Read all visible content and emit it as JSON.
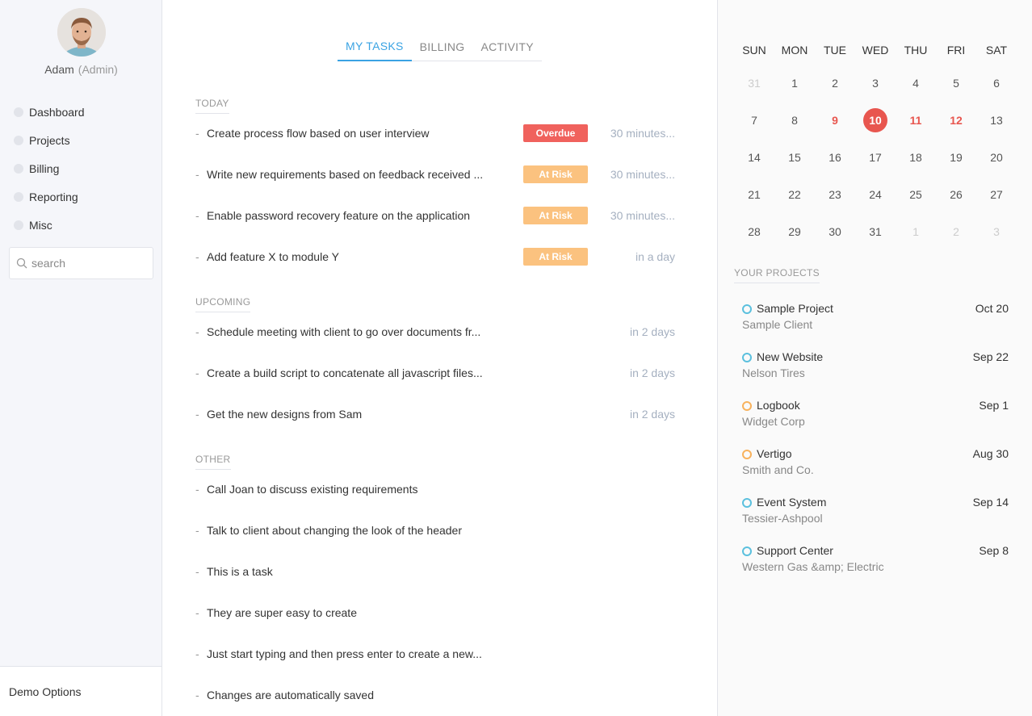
{
  "user": {
    "name": "Adam",
    "role": "(Admin)"
  },
  "sidebar": {
    "items": [
      {
        "label": "Dashboard"
      },
      {
        "label": "Projects"
      },
      {
        "label": "Billing"
      },
      {
        "label": "Reporting"
      },
      {
        "label": "Misc"
      }
    ],
    "search_placeholder": "search",
    "demo_label": "Demo Options"
  },
  "tabs": [
    {
      "label": "MY TASKS",
      "active": true
    },
    {
      "label": "BILLING",
      "active": false
    },
    {
      "label": "ACTIVITY",
      "active": false
    }
  ],
  "sections": {
    "today": {
      "label": "TODAY",
      "tasks": [
        {
          "title": "Create process flow based on user interview",
          "badge": "Overdue",
          "due": "30 minutes..."
        },
        {
          "title": "Write new requirements based on feedback received ...",
          "badge": "At Risk",
          "due": "30 minutes..."
        },
        {
          "title": "Enable password recovery feature on the application",
          "badge": "At Risk",
          "due": "30 minutes..."
        },
        {
          "title": "Add feature X to module Y",
          "badge": "At Risk",
          "due": "in a day"
        }
      ]
    },
    "upcoming": {
      "label": "UPCOMING",
      "tasks": [
        {
          "title": "Schedule meeting with client to go over documents fr...",
          "due": "in 2 days"
        },
        {
          "title": "Create a build script to concatenate all javascript files...",
          "due": "in 2 days"
        },
        {
          "title": "Get the new designs from Sam",
          "due": "in 2 days"
        }
      ]
    },
    "other": {
      "label": "OTHER",
      "tasks": [
        {
          "title": "Call Joan to discuss existing requirements"
        },
        {
          "title": "Talk to client about changing the look of the header"
        },
        {
          "title": "This is a task"
        },
        {
          "title": "They are super easy to create"
        },
        {
          "title": "Just start typing and then press enter to create a new..."
        },
        {
          "title": "Changes are automatically saved"
        }
      ]
    }
  },
  "colors": {
    "overdue": "#f0625d",
    "at_risk": "#fbc27f",
    "accent": "#3aa3e3",
    "highlight": "#e8564f",
    "ring_blue": "#5bc0de",
    "ring_orange": "#f8b25d"
  },
  "calendar": {
    "weekdays": [
      "SUN",
      "MON",
      "TUE",
      "WED",
      "THU",
      "FRI",
      "SAT"
    ],
    "weeks": [
      [
        {
          "d": "31",
          "m": true
        },
        {
          "d": "1"
        },
        {
          "d": "2"
        },
        {
          "d": "3"
        },
        {
          "d": "4"
        },
        {
          "d": "5"
        },
        {
          "d": "6"
        }
      ],
      [
        {
          "d": "7"
        },
        {
          "d": "8"
        },
        {
          "d": "9",
          "hl": true
        },
        {
          "d": "10",
          "today": true
        },
        {
          "d": "11",
          "hl": true
        },
        {
          "d": "12",
          "hl": true
        },
        {
          "d": "13"
        }
      ],
      [
        {
          "d": "14"
        },
        {
          "d": "15"
        },
        {
          "d": "16"
        },
        {
          "d": "17"
        },
        {
          "d": "18"
        },
        {
          "d": "19"
        },
        {
          "d": "20"
        }
      ],
      [
        {
          "d": "21"
        },
        {
          "d": "22"
        },
        {
          "d": "23"
        },
        {
          "d": "24"
        },
        {
          "d": "25"
        },
        {
          "d": "26"
        },
        {
          "d": "27"
        }
      ],
      [
        {
          "d": "28"
        },
        {
          "d": "29"
        },
        {
          "d": "30"
        },
        {
          "d": "31"
        },
        {
          "d": "1",
          "m": true
        },
        {
          "d": "2",
          "m": true
        },
        {
          "d": "3",
          "m": true
        }
      ]
    ]
  },
  "projects": {
    "label": "YOUR PROJECTS",
    "items": [
      {
        "name": "Sample Project",
        "client": "Sample Client",
        "date": "Oct 20",
        "status": "blue"
      },
      {
        "name": "New Website",
        "client": "Nelson Tires",
        "date": "Sep 22",
        "status": "blue"
      },
      {
        "name": "Logbook",
        "client": "Widget Corp",
        "date": "Sep 1",
        "status": "orange"
      },
      {
        "name": "Vertigo",
        "client": "Smith and Co.",
        "date": "Aug 30",
        "status": "orange"
      },
      {
        "name": "Event System",
        "client": "Tessier-Ashpool",
        "date": "Sep 14",
        "status": "blue"
      },
      {
        "name": "Support Center",
        "client": "Western Gas &amp; Electric",
        "date": "Sep 8",
        "status": "blue"
      }
    ]
  }
}
